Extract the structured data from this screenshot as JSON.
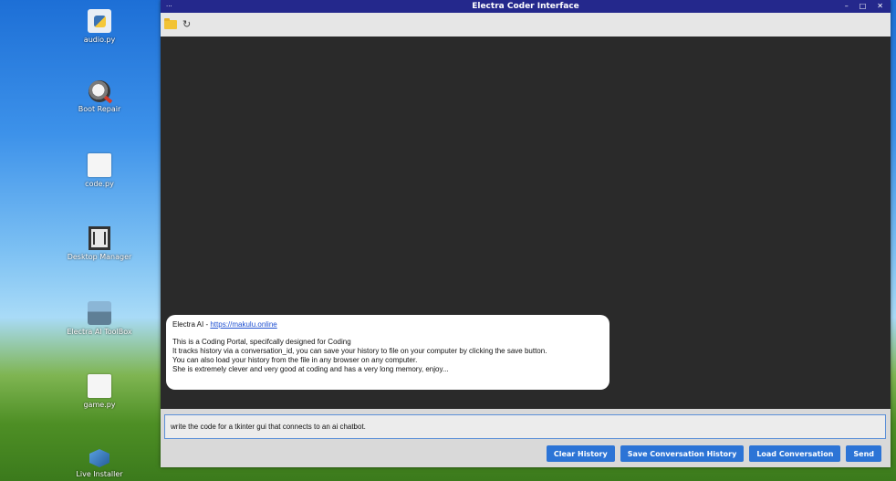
{
  "desktop": {
    "icons": [
      {
        "label": "audio.py",
        "icon": "python-file-icon"
      },
      {
        "label": "Boot Repair",
        "icon": "boot-repair-icon"
      },
      {
        "label": "code.py",
        "icon": "document-icon"
      },
      {
        "label": "Desktop Manager",
        "icon": "desktop-manager-icon"
      },
      {
        "label": "Electra AI ToolBox",
        "icon": "toolbox-icon"
      },
      {
        "label": "game.py",
        "icon": "document-icon"
      },
      {
        "label": "Live Installer",
        "icon": "installer-icon"
      }
    ]
  },
  "window": {
    "title": "Electra Coder Interface",
    "menu_glyph": "···",
    "controls": {
      "minimize": "–",
      "maximize": "□",
      "close": "✕"
    },
    "toolbar": {
      "folder_icon": "folder-icon",
      "refresh_icon": "refresh-icon",
      "refresh_glyph": "↻"
    }
  },
  "chat": {
    "message": {
      "title_prefix": "Electra AI - ",
      "link": "https://makulu.online",
      "lines": [
        "This is a Coding Portal, specifcally designed for Coding",
        "It tracks history via a conversation_id, you can save your history to file on your computer by clicking the save button.",
        "You can also load your history from the file in any browser on any computer.",
        "She is extremely clever and very good at coding and has a very long memory, enjoy..."
      ]
    }
  },
  "input": {
    "value": "write the code for a tkinter gui that connects to an ai chatbot."
  },
  "buttons": {
    "clear": "Clear History",
    "save": "Save Conversation History",
    "load": "Load Conversation",
    "send": "Send"
  },
  "colors": {
    "titlebar": "#24288c",
    "chat_bg": "#2a2a2a",
    "button": "#2c74d6",
    "link": "#1d4fd1"
  }
}
